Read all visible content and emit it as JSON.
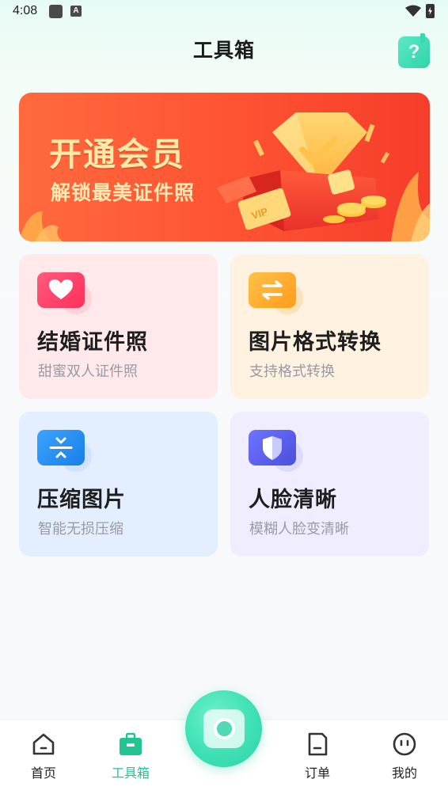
{
  "status_bar": {
    "time": "4:08",
    "a_icon": "A"
  },
  "header": {
    "title": "工具箱",
    "help_icon": "?"
  },
  "banner": {
    "title": "开通会员",
    "subtitle": "解锁最美证件照",
    "badge": "VIP"
  },
  "tools": [
    {
      "title": "结婚证件照",
      "desc": "甜蜜双人证件照",
      "icon": "heart-icon",
      "color": "#ff3d6b"
    },
    {
      "title": "图片格式转换",
      "desc": "支持格式转换",
      "icon": "swap-arrows-icon",
      "color": "#ffae2a"
    },
    {
      "title": "压缩图片",
      "desc": "智能无损压缩",
      "icon": "compress-icon",
      "color": "#2d8ff0"
    },
    {
      "title": "人脸清晰",
      "desc": "模糊人脸变清晰",
      "icon": "shield-face-icon",
      "color": "#5c63ee"
    }
  ],
  "bottom_nav": {
    "items": [
      {
        "label": "首页",
        "icon": "home-icon",
        "active": false
      },
      {
        "label": "工具箱",
        "icon": "toolbox-icon",
        "active": true
      },
      {
        "label": "订单",
        "icon": "order-icon",
        "active": false
      },
      {
        "label": "我的",
        "icon": "profile-icon",
        "active": false
      }
    ],
    "center_button_icon": "camera-icon"
  },
  "colors": {
    "accent": "#22c493",
    "banner": "#ff5634"
  }
}
